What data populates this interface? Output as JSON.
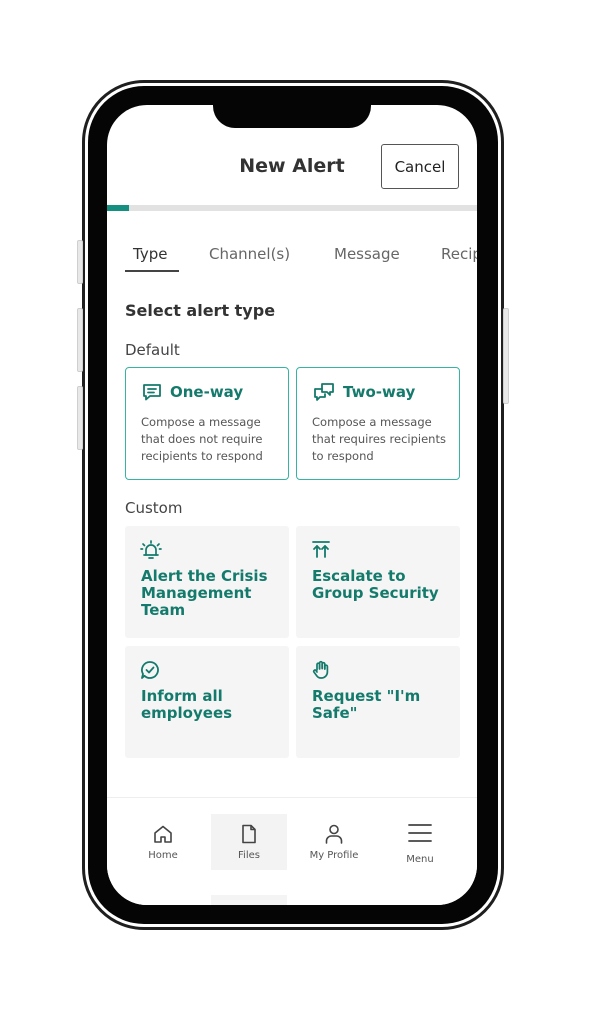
{
  "header": {
    "title": "New Alert",
    "cancel_label": "Cancel"
  },
  "progress": {
    "fraction": 0.06,
    "color": "#148f80"
  },
  "tabs": [
    {
      "label": "Type",
      "active": true
    },
    {
      "label": "Channel(s)",
      "active": false
    },
    {
      "label": "Message",
      "active": false
    },
    {
      "label": "Recipients",
      "active": false
    }
  ],
  "section_title": "Select alert type",
  "default_group": {
    "label": "Default",
    "options": [
      {
        "icon": "message-icon",
        "title": "One-way",
        "description": "Compose a message that does not require recipients to respond"
      },
      {
        "icon": "conversation-icon",
        "title": "Two-way",
        "description": "Compose a message that requires recipients to respond"
      }
    ]
  },
  "custom_group": {
    "label": "Custom",
    "options": [
      {
        "icon": "alarm-bell-icon",
        "title": "Alert the Crisis Management Team"
      },
      {
        "icon": "escalate-icon",
        "title": "Escalate to Group Security"
      },
      {
        "icon": "check-bubble-icon",
        "title": "Inform all employees"
      },
      {
        "icon": "raised-hand-icon",
        "title": "Request \"I'm Safe\""
      }
    ]
  },
  "bottom_nav": [
    {
      "icon": "home-icon",
      "label": "Home"
    },
    {
      "icon": "file-icon",
      "label": "Files",
      "selected": true
    },
    {
      "icon": "user-icon",
      "label": "My Profile"
    },
    {
      "icon": "hamburger-menu-icon",
      "label": "Menu"
    }
  ],
  "colors": {
    "accent": "#147a6c",
    "card_border": "#36b3a2",
    "card_bg": "#f5f5f5"
  }
}
